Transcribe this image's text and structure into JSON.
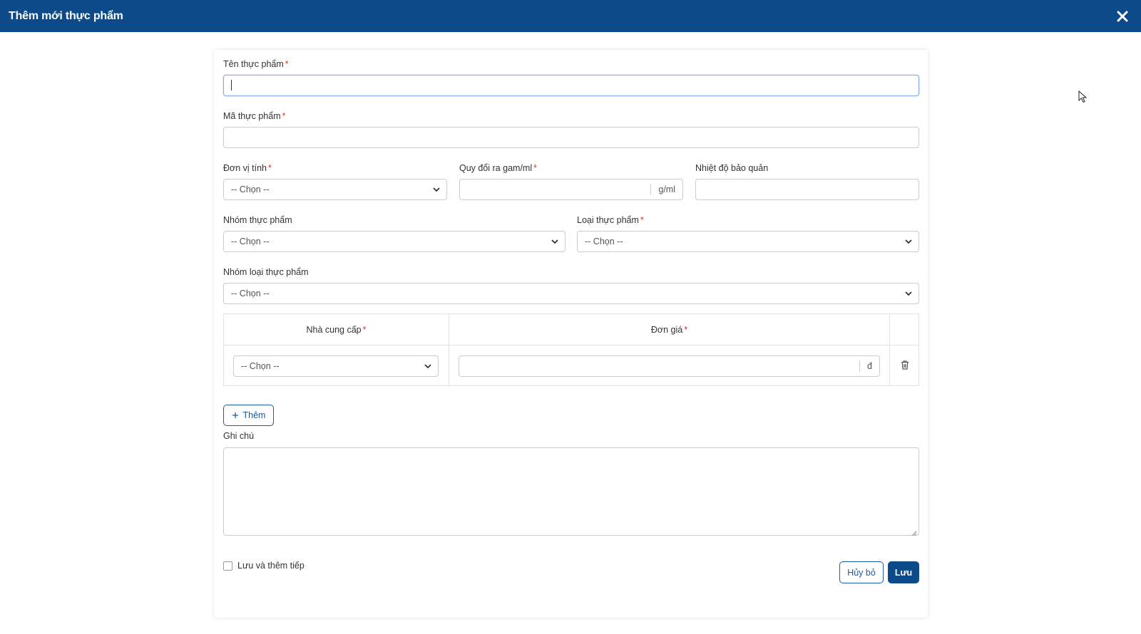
{
  "dialog": {
    "title": "Thêm mới thực phẩm",
    "close_icon": "close-icon"
  },
  "form": {
    "ten_thuc_pham": {
      "label": "Tên thực phẩm",
      "required": "*",
      "value": ""
    },
    "ma_thuc_pham": {
      "label": "Mã thực phẩm",
      "required": "*",
      "value": ""
    },
    "don_vi_tinh": {
      "label": "Đơn vị tính",
      "required": "*",
      "selected": "-- Chọn --"
    },
    "quy_doi": {
      "label": "Quy đổi ra gam/ml",
      "required": "*",
      "value": "",
      "unit": "g/ml"
    },
    "nhiet_do": {
      "label": "Nhiệt độ bảo quản",
      "value": ""
    },
    "nhom_thuc_pham": {
      "label": "Nhóm thực phẩm",
      "selected": "-- Chọn --"
    },
    "loai_thuc_pham": {
      "label": "Loại thực phẩm",
      "required": "*",
      "selected": "-- Chọn --"
    },
    "nhom_loai_thuc_pham": {
      "label": "Nhóm loại thực phẩm",
      "selected": "-- Chọn --"
    },
    "supplier_table": {
      "headers": {
        "supplier": "Nhà cung cấp",
        "price": "Đơn giá",
        "required": "*"
      },
      "rows": [
        {
          "supplier_selected": "-- Chọn --",
          "price_value": "",
          "price_unit": "đ",
          "delete_icon": "trash-icon"
        }
      ]
    },
    "add_button": {
      "icon": "plus-icon",
      "label": "Thêm"
    },
    "ghi_chu": {
      "label": "Ghi chú",
      "value": ""
    },
    "save_and_continue": {
      "label": "Lưu và thêm tiếp",
      "checked": false
    },
    "cancel_button": "Hủy bỏ",
    "save_button": "Lưu"
  },
  "colors": {
    "primary": "#0d4a8a",
    "required": "#e0342b",
    "border": "#c9ccd1"
  }
}
